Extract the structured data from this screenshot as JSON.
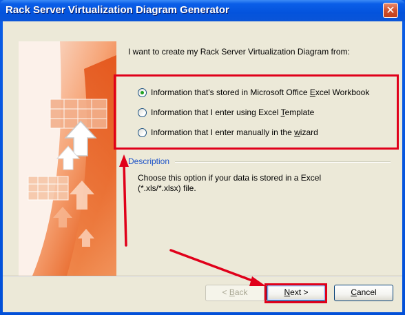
{
  "window": {
    "title": "Rack Server Virtualization Diagram Generator",
    "close_glyph": "✕"
  },
  "prompt": "I want to create my Rack Server Virtualization Diagram from:",
  "options": [
    {
      "before": "Information that's stored in Microsoft Office ",
      "accel": "E",
      "after": "xcel Workbook",
      "checked": true
    },
    {
      "before": "Information that I enter using Excel ",
      "accel": "T",
      "after": "emplate",
      "checked": false
    },
    {
      "before": "Information that I enter manually in the ",
      "accel": "w",
      "after": "izard",
      "checked": false
    }
  ],
  "description": {
    "label": "Description",
    "text": "Choose this option if your data is stored in a Excel (*.xls/*.xlsx) file."
  },
  "buttons": {
    "back": {
      "prefix": "< ",
      "accel": "B",
      "rest": "ack",
      "enabled": false
    },
    "next": {
      "accel": "N",
      "rest": "ext >",
      "default": true
    },
    "cancel": {
      "accel": "C",
      "rest": "ancel"
    }
  },
  "colors": {
    "annotation_red": "#e0001a",
    "radio_selected": "#21a121",
    "description_label": "#2055c8",
    "title_bar": "#0453dc",
    "client_bg": "#ece9d8"
  },
  "icons": [
    "close-icon",
    "wizard-banner-graphic",
    "radio-icon",
    "annotation-arrow"
  ]
}
